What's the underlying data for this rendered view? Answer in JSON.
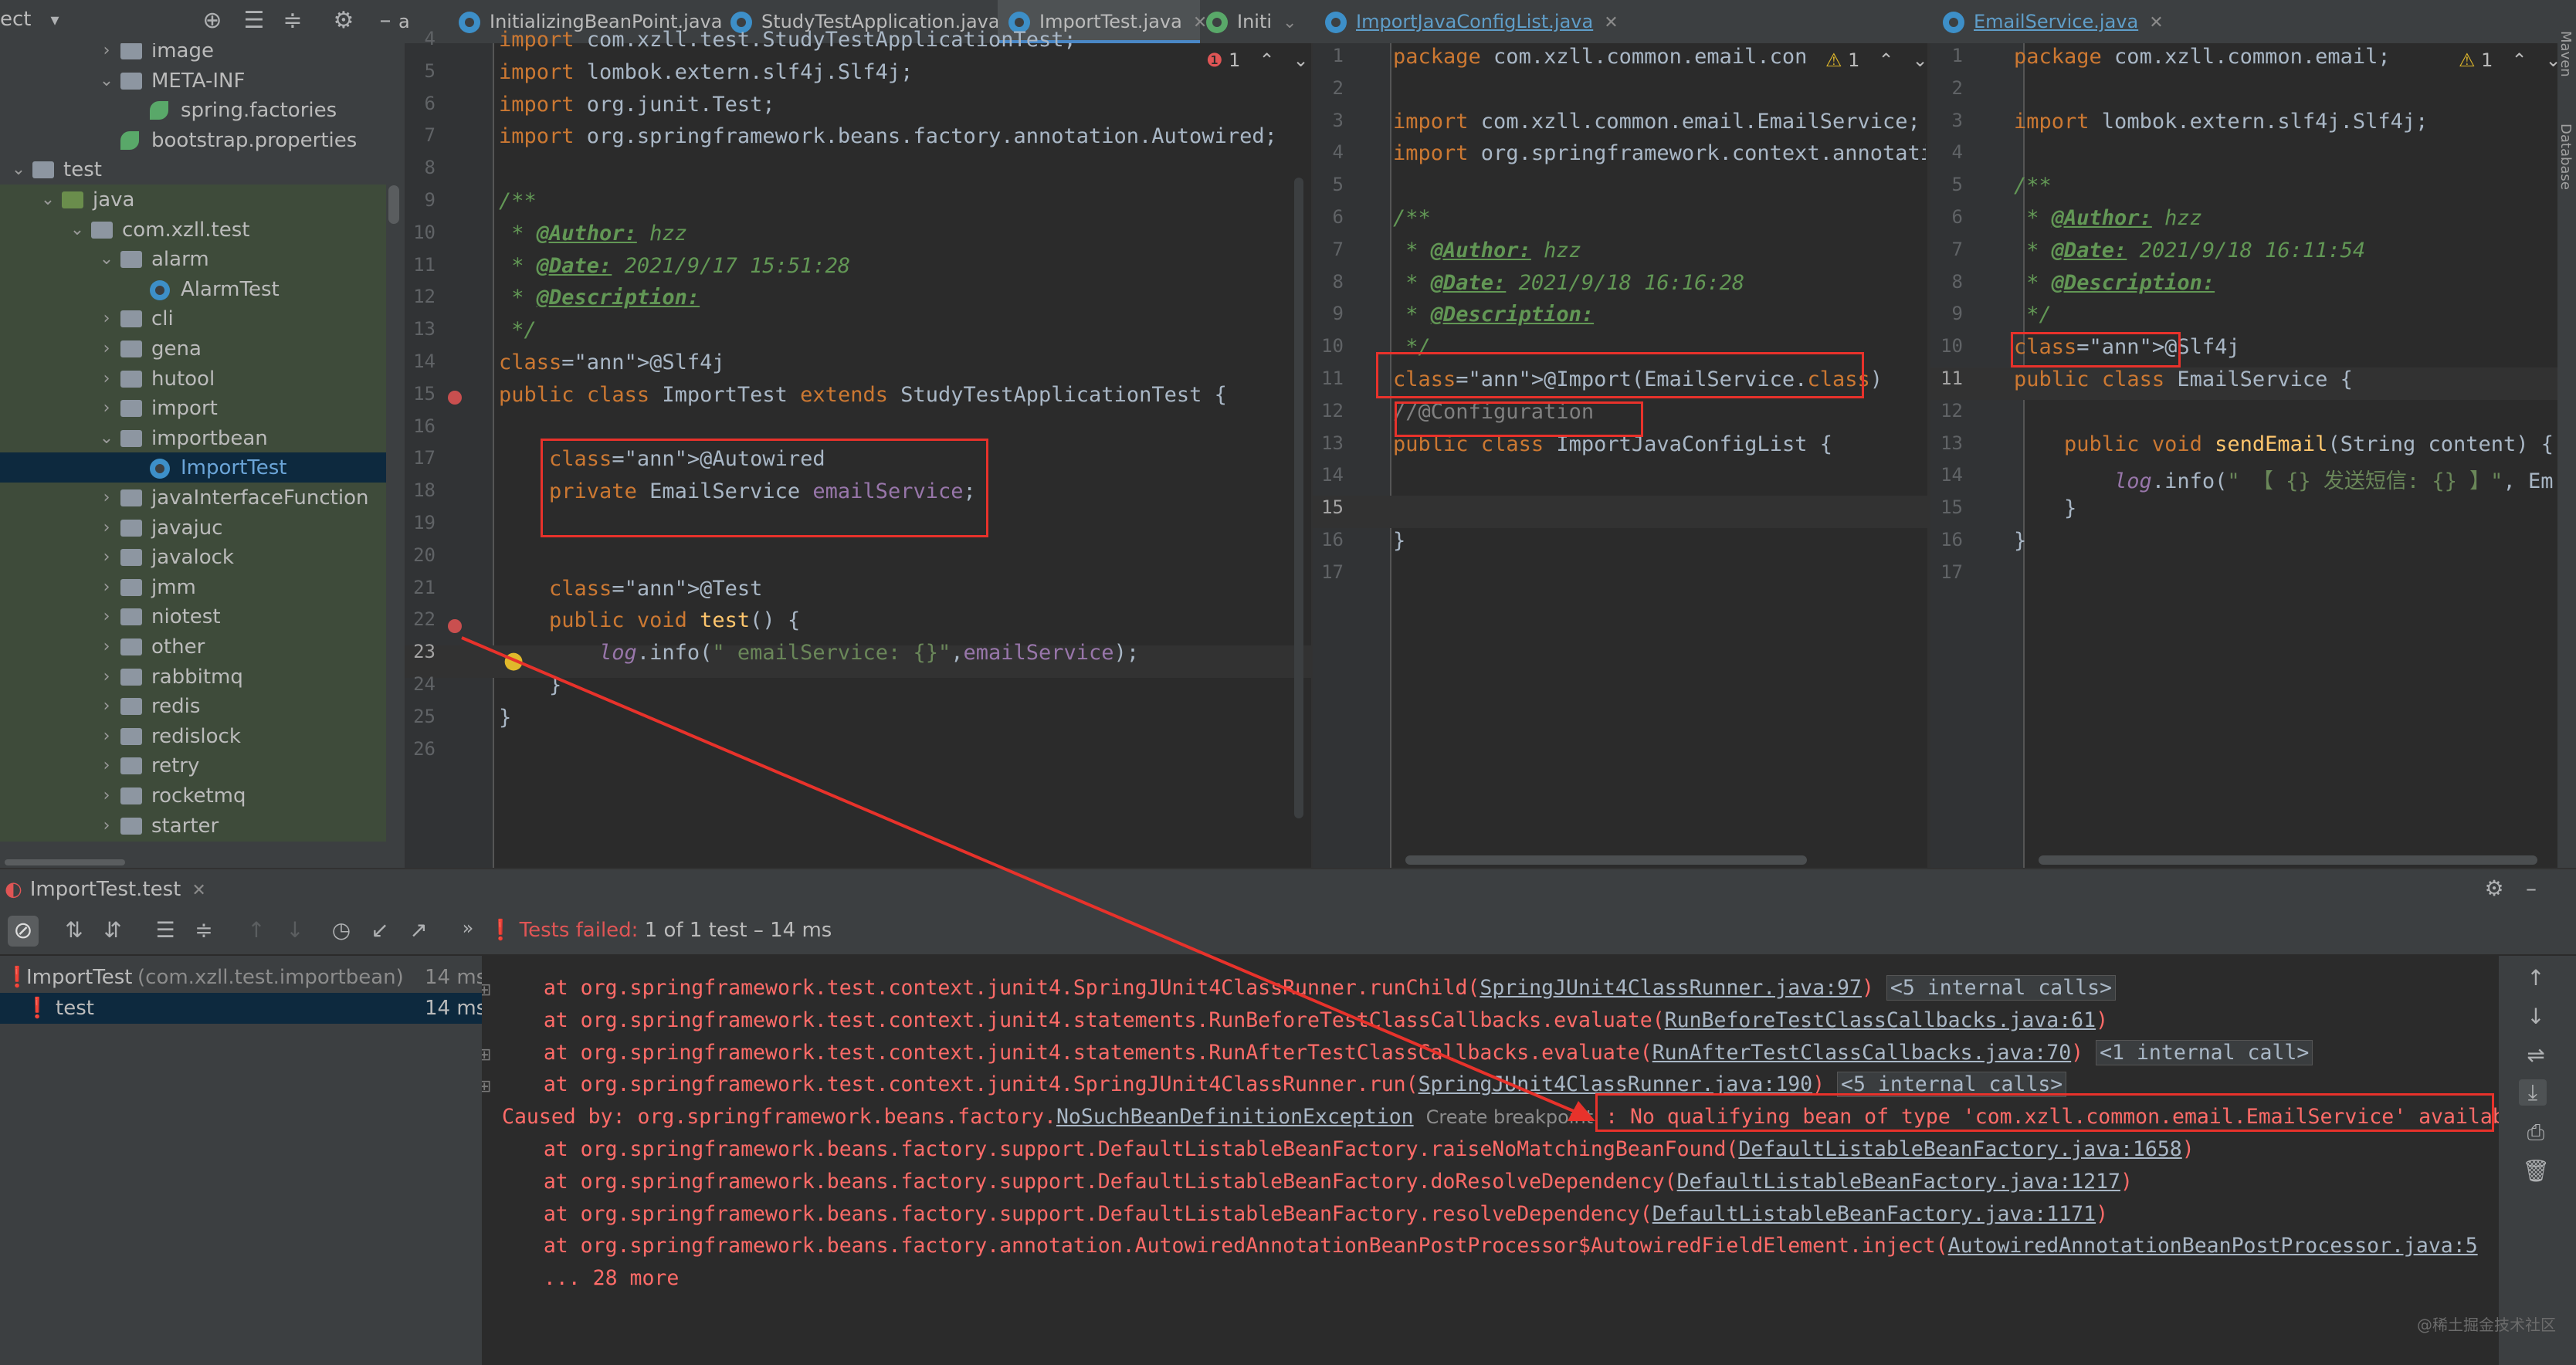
{
  "project": {
    "title": "ect",
    "tree": [
      {
        "label": "image",
        "depth": 3,
        "type": "folder",
        "expanded": false
      },
      {
        "label": "META-INF",
        "depth": 3,
        "type": "folder",
        "expanded": true
      },
      {
        "label": "spring.factories",
        "depth": 4,
        "type": "spring"
      },
      {
        "label": "bootstrap.properties",
        "depth": 3,
        "type": "spring"
      },
      {
        "label": "test",
        "depth": 0,
        "type": "folder",
        "expanded": true
      },
      {
        "label": "java",
        "depth": 1,
        "type": "folder-green",
        "expanded": true
      },
      {
        "label": "com.xzll.test",
        "depth": 2,
        "type": "folder",
        "expanded": true
      },
      {
        "label": "alarm",
        "depth": 3,
        "type": "folder",
        "expanded": true
      },
      {
        "label": "AlarmTest",
        "depth": 4,
        "type": "class"
      },
      {
        "label": "cli",
        "depth": 3,
        "type": "folder",
        "expanded": false
      },
      {
        "label": "gena",
        "depth": 3,
        "type": "folder",
        "expanded": false
      },
      {
        "label": "hutool",
        "depth": 3,
        "type": "folder",
        "expanded": false
      },
      {
        "label": "import",
        "depth": 3,
        "type": "folder",
        "expanded": false
      },
      {
        "label": "importbean",
        "depth": 3,
        "type": "folder",
        "expanded": true
      },
      {
        "label": "ImportTest",
        "depth": 4,
        "type": "class",
        "selected": true
      },
      {
        "label": "javaInterfaceFunction",
        "depth": 3,
        "type": "folder",
        "expanded": false
      },
      {
        "label": "javajuc",
        "depth": 3,
        "type": "folder",
        "expanded": false
      },
      {
        "label": "javalock",
        "depth": 3,
        "type": "folder",
        "expanded": false
      },
      {
        "label": "jmm",
        "depth": 3,
        "type": "folder",
        "expanded": false
      },
      {
        "label": "niotest",
        "depth": 3,
        "type": "folder",
        "expanded": false
      },
      {
        "label": "other",
        "depth": 3,
        "type": "folder",
        "expanded": false
      },
      {
        "label": "rabbitmq",
        "depth": 3,
        "type": "folder",
        "expanded": false
      },
      {
        "label": "redis",
        "depth": 3,
        "type": "folder",
        "expanded": false
      },
      {
        "label": "redislock",
        "depth": 3,
        "type": "folder",
        "expanded": false
      },
      {
        "label": "retry",
        "depth": 3,
        "type": "folder",
        "expanded": false
      },
      {
        "label": "rocketmq",
        "depth": 3,
        "type": "folder",
        "expanded": false
      },
      {
        "label": "starter",
        "depth": 3,
        "type": "folder",
        "expanded": false
      }
    ]
  },
  "tabs": {
    "left": [
      {
        "label": "a"
      },
      {
        "label": "InitializingBeanPoint.java"
      },
      {
        "label": "StudyTestApplication.java"
      },
      {
        "label": "ImportTest.java",
        "active": true
      },
      {
        "label": "Initi"
      }
    ],
    "middle": [
      {
        "label": "ImportJavaConfigList.java"
      }
    ],
    "right": [
      {
        "label": "EmailService.java"
      }
    ]
  },
  "editor1": {
    "warning_count": "1",
    "line_numbers": [
      "4",
      "5",
      "6",
      "7",
      "8",
      "9",
      "10",
      "11",
      "12",
      "13",
      "14",
      "15",
      "16",
      "17",
      "18",
      "19",
      "20",
      "21",
      "22",
      "23",
      "24",
      "25",
      "26"
    ],
    "lines": [
      "import com.xzll.test.StudyTestApplicationTest;",
      "import lombok.extern.slf4j.Slf4j;",
      "import org.junit.Test;",
      "import org.springframework.beans.factory.annotation.Autowired;",
      "",
      "/**",
      " * @Author: hzz",
      " * @Date: 2021/9/17 15:51:28",
      " * @Description:",
      " */",
      "@Slf4j",
      "public class ImportTest extends StudyTestApplicationTest {",
      "",
      "    @Autowired",
      "    private EmailService emailService;",
      "",
      "",
      "    @Test",
      "    public void test() {",
      "        log.info(\" emailService: {}\",emailService);",
      "    }",
      "}",
      ""
    ]
  },
  "editor2": {
    "warning_count": "1",
    "line_numbers": [
      "1",
      "2",
      "3",
      "4",
      "5",
      "6",
      "7",
      "8",
      "9",
      "10",
      "11",
      "12",
      "13",
      "14",
      "15",
      "16",
      "17"
    ],
    "lines": [
      "package com.xzll.common.email.con",
      "",
      "import com.xzll.common.email.EmailService;",
      "import org.springframework.context.annotati",
      "",
      "/**",
      " * @Author: hzz",
      " * @Date: 2021/9/18 16:16:28",
      " * @Description:",
      " */",
      "@Import(EmailService.class)",
      "//@Configuration",
      "public class ImportJavaConfigList {",
      "",
      "",
      "}",
      ""
    ]
  },
  "editor3": {
    "warning_count": "1",
    "side_label": "Database",
    "side_label_top": "Maven",
    "line_numbers": [
      "1",
      "2",
      "3",
      "4",
      "5",
      "6",
      "7",
      "8",
      "9",
      "10",
      "11",
      "12",
      "13",
      "14",
      "15",
      "16",
      "17"
    ],
    "lines": [
      "package com.xzll.common.email;",
      "",
      "import lombok.extern.slf4j.Slf4j;",
      "",
      "/**",
      " * @Author: hzz",
      " * @Date: 2021/9/18 16:11:54",
      " * @Description:",
      " */",
      "@Slf4j",
      "public class EmailService {",
      "",
      "    public void sendEmail(String content) {",
      "        log.info(\" 【 {} 发送短信: {} 】\", Em",
      "    }",
      "}",
      ""
    ]
  },
  "run": {
    "tab_label": "ImportTest.test",
    "status_text": "Tests failed:",
    "status_count": "1 of 1 test – 14 ms",
    "tree": [
      {
        "label": "ImportTest",
        "pkg": "(com.xzll.test.importbean)",
        "time": "14 ms"
      },
      {
        "label": "test",
        "pkg": "",
        "time": "14 ms"
      }
    ],
    "console": [
      {
        "prefix": "    at org.springframework.test.context.junit4.SpringJUnit4ClassRunner.runChild(",
        "link": "SpringJUnit4ClassRunner.java:97",
        "suffix": ")",
        "internal": "<5 internal calls>"
      },
      {
        "prefix": "    at org.springframework.test.context.junit4.statements.RunBeforeTestClassCallbacks.evaluate(",
        "link": "RunBeforeTestClassCallbacks.java:61",
        "suffix": ")",
        "internal": ""
      },
      {
        "prefix": "    at org.springframework.test.context.junit4.statements.RunAfterTestClassCallbacks.evaluate(",
        "link": "RunAfterTestClassCallbacks.java:70",
        "suffix": ")",
        "internal": "<1 internal call>"
      },
      {
        "prefix": "    at org.springframework.test.context.junit4.SpringJUnit4ClassRunner.run(",
        "link": "SpringJUnit4ClassRunner.java:190",
        "suffix": ")",
        "internal": "<5 internal calls>"
      },
      {
        "prefix": "Caused by: org.springframework.beans.factory.",
        "link": "NoSuchBeanDefinitionException",
        "suffix": "",
        "internal": "",
        "breakpoint": "Create breakpoint",
        "message": ": No qualifying bean of type 'com.xzll.common.email.EmailService' availab"
      },
      {
        "prefix": "    at org.springframework.beans.factory.support.DefaultListableBeanFactory.raiseNoMatchingBeanFound(",
        "link": "DefaultListableBeanFactory.java:1658",
        "suffix": ")",
        "internal": ""
      },
      {
        "prefix": "    at org.springframework.beans.factory.support.DefaultListableBeanFactory.doResolveDependency(",
        "link": "DefaultListableBeanFactory.java:1217",
        "suffix": ")",
        "internal": ""
      },
      {
        "prefix": "    at org.springframework.beans.factory.support.DefaultListableBeanFactory.resolveDependency(",
        "link": "DefaultListableBeanFactory.java:1171",
        "suffix": ")",
        "internal": ""
      },
      {
        "prefix": "    at org.springframework.beans.factory.annotation.AutowiredAnnotationBeanPostProcessor$AutowiredFieldElement.inject(",
        "link": "AutowiredAnnotationBeanPostProcessor.java:5",
        "suffix": "",
        "internal": ""
      },
      {
        "prefix": "    ... 28 more",
        "link": "",
        "suffix": "",
        "internal": ""
      }
    ]
  },
  "watermark": "@稀土掘金技术社区",
  "colors": {
    "error": "#e8322b",
    "accent": "#4a88c7"
  }
}
